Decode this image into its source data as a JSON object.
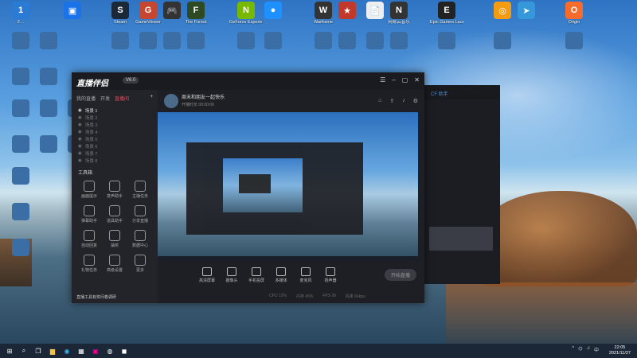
{
  "desktop_icons": [
    {
      "label": "2…",
      "letter": "1",
      "color": "#2a7bd5"
    },
    {
      "label": "",
      "letter": "▣",
      "color": "#1a73e8"
    },
    {
      "label": "Steam",
      "letter": "S",
      "color": "#1b2838"
    },
    {
      "label": "GameViewer",
      "letter": "G",
      "color": "#c7462f"
    },
    {
      "label": "",
      "letter": "🎮",
      "color": "#333"
    },
    {
      "label": "The Forest",
      "letter": "F",
      "color": "#2d4a23"
    },
    {
      "label": "GeForce Experience",
      "letter": "N",
      "color": "#76b900"
    },
    {
      "label": "",
      "letter": "●",
      "color": "#1e90ff"
    },
    {
      "label": "Warframe",
      "letter": "W",
      "color": "#333"
    },
    {
      "label": "",
      "letter": "★",
      "color": "#c0392b"
    },
    {
      "label": "",
      "letter": "📄",
      "color": "#eee"
    },
    {
      "label": "网易云音乐",
      "letter": "N",
      "color": "#333"
    },
    {
      "label": "Epic Games Launcher",
      "letter": "E",
      "color": "#222"
    },
    {
      "label": "",
      "letter": "◎",
      "color": "#f39c12"
    },
    {
      "label": "",
      "letter": "➤",
      "color": "#3498db"
    },
    {
      "label": "Origin",
      "letter": "O",
      "color": "#f56c2d"
    }
  ],
  "stream_window": {
    "app_name": "直播伴侣",
    "version_badge": "V6.0",
    "side_tabs": [
      "我的直播",
      "开发",
      "直播间"
    ],
    "scene_items": [
      "场景 1",
      "场景 2",
      "场景 3",
      "场景 4",
      "场景 5",
      "场景 6",
      "场景 7",
      "场景 8"
    ],
    "active_scene": "场景 1",
    "tools_header": "工具箱",
    "tools": [
      "画面提示",
      "变声助手",
      "主播任务",
      "弹幕助手",
      "道具助手",
      "分享直播",
      "自动回复",
      "抽奖",
      "数据中心",
      "礼物任务",
      "高级设置",
      "更多"
    ],
    "promo_text": "直播工具有奖问卷调研",
    "room_title": "周末和朋友一起快乐",
    "room_meta": "开播时长 00:00:00",
    "controls": [
      "高清屏幕",
      "摄像头",
      "手机投屏",
      "多媒体",
      "麦克风",
      "扬声器"
    ],
    "go_live": "开始直播",
    "status": [
      "CPU 12%",
      "内存 45%",
      "FPS 30",
      "码率 0kbps"
    ]
  },
  "back_window": {
    "title": "CF 助手"
  },
  "taskbar": {
    "time": "22:05",
    "date": "2021/11/27",
    "tray_lang": "中"
  }
}
